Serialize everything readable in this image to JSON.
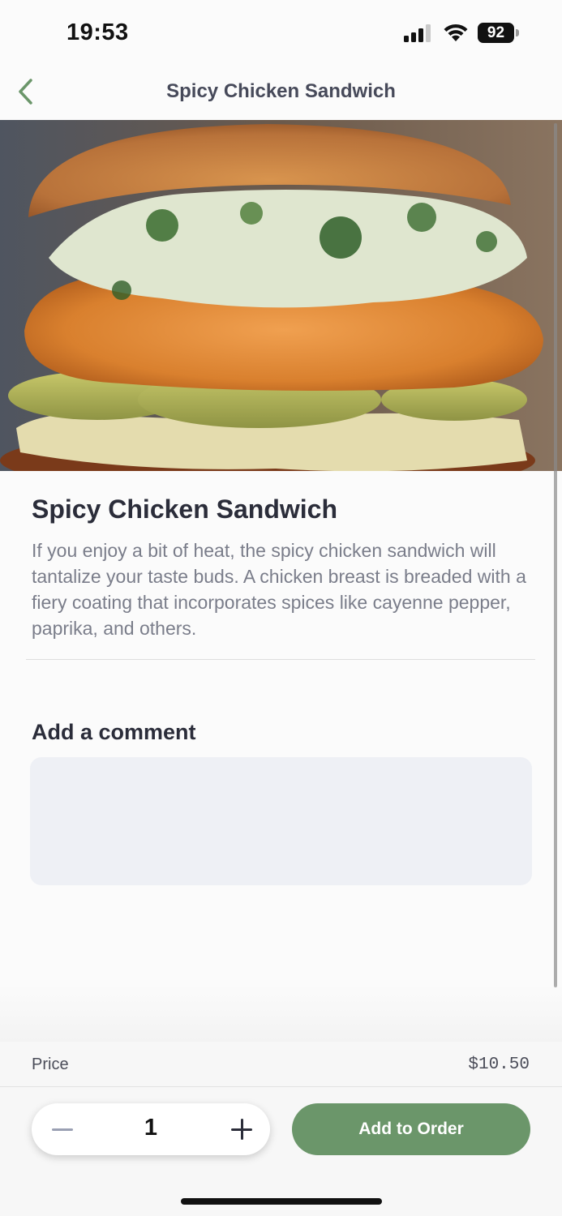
{
  "status_bar": {
    "time": "19:53",
    "battery": "92",
    "icons": [
      "signal-icon",
      "wifi-icon",
      "battery-icon"
    ]
  },
  "nav": {
    "title": "Spicy Chicken Sandwich",
    "back_icon": "chevron-left-icon"
  },
  "colors": {
    "accent": "#6b966a",
    "title_text": "#2b2d3a",
    "body_text": "#7a7d8a",
    "input_bg": "#eef0f5"
  },
  "item": {
    "name": "Spicy Chicken Sandwich",
    "description": "If you enjoy a bit of heat, the spicy chicken sandwich will tantalize your taste buds. A chicken breast is breaded with a fiery coating that incorporates spices like cayenne pepper, paprika, and others."
  },
  "comment": {
    "label": "Add a comment",
    "value": "",
    "placeholder": ""
  },
  "footer": {
    "price_label": "Price",
    "price_value": "$10.50",
    "quantity": "1",
    "add_button_label": "Add to Order"
  }
}
